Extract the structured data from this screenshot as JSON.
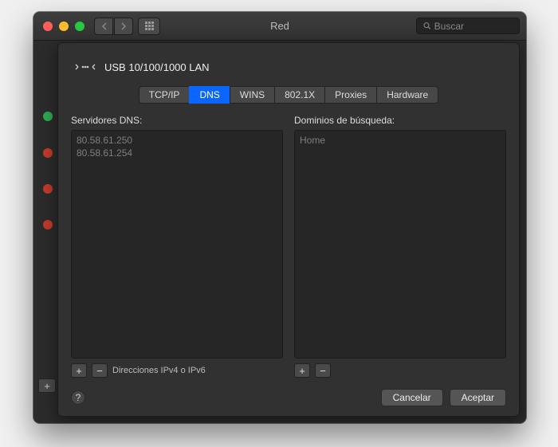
{
  "window": {
    "title": "Red",
    "search_placeholder": "Buscar"
  },
  "sheet": {
    "adapter_name": "USB 10/100/1000 LAN",
    "tabs": {
      "tcpip": "TCP/IP",
      "dns": "DNS",
      "wins": "WINS",
      "8021x": "802.1X",
      "proxies": "Proxies",
      "hardware": "Hardware"
    },
    "dns": {
      "label": "Servidores DNS:",
      "servers": [
        "80.58.61.250",
        "80.58.61.254"
      ],
      "hint": "Direcciones IPv4 o IPv6"
    },
    "search_domains": {
      "label": "Dominios de búsqueda:",
      "domains": [
        "Home"
      ]
    },
    "buttons": {
      "cancel": "Cancelar",
      "accept": "Aceptar"
    }
  }
}
